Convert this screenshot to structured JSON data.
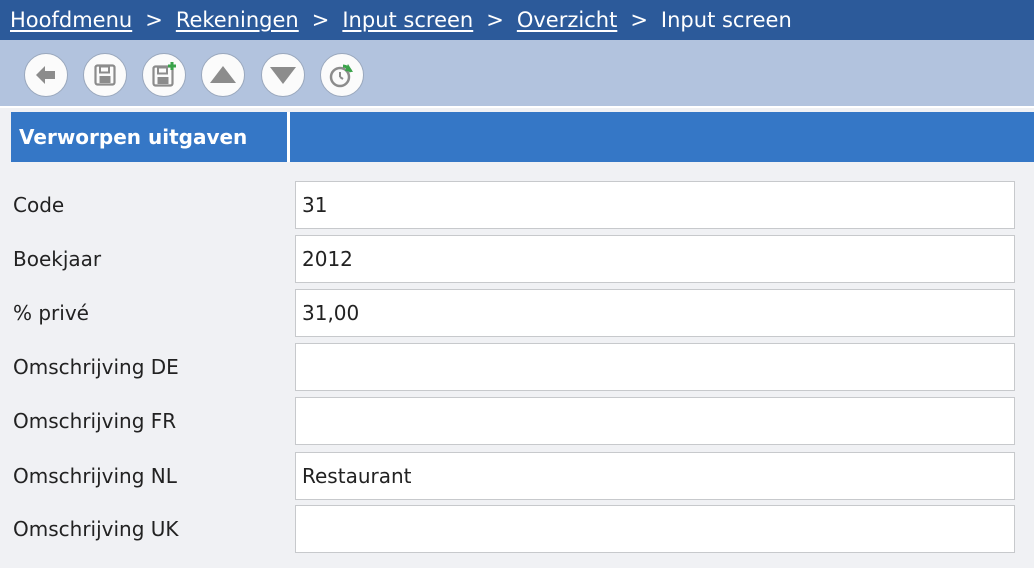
{
  "breadcrumb": {
    "items": [
      {
        "label": "Hoofdmenu"
      },
      {
        "label": "Rekeningen"
      },
      {
        "label": "Input screen"
      },
      {
        "label": "Overzicht"
      }
    ],
    "separator": ">",
    "current": "Input screen"
  },
  "toolbar": {
    "buttons": [
      {
        "icon": "back-arrow-icon"
      },
      {
        "icon": "save-icon"
      },
      {
        "icon": "save-new-icon"
      },
      {
        "icon": "arrow-up-icon"
      },
      {
        "icon": "arrow-down-icon"
      },
      {
        "icon": "refresh-icon"
      }
    ]
  },
  "section": {
    "title": "Verworpen uitgaven"
  },
  "form": {
    "fields": [
      {
        "label": "Code",
        "value": "31"
      },
      {
        "label": "Boekjaar",
        "value": "2012"
      },
      {
        "label": "% privé",
        "value": "31,00"
      },
      {
        "label": "Omschrijving DE",
        "value": ""
      },
      {
        "label": "Omschrijving FR",
        "value": ""
      },
      {
        "label": "Omschrijving NL",
        "value": "Restaurant"
      },
      {
        "label": "Omschrijving UK",
        "value": ""
      }
    ]
  },
  "colors": {
    "breadcrumb_bg": "#2c5a9a",
    "toolbar_bg": "#b2c3de",
    "section_header_bg": "#3577c6",
    "page_bg": "#f0f1f4",
    "icon_gray": "#8c8c8c",
    "icon_green": "#3aa34a"
  }
}
